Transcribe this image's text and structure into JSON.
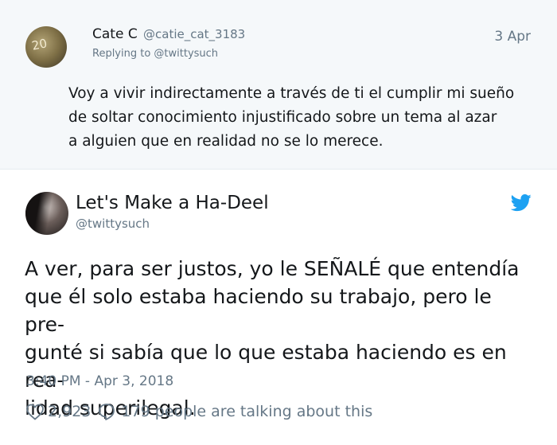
{
  "reply": {
    "name": "Cate C",
    "handle": "@catie_cat_3183",
    "replying_to": "Replying to @twittysuch",
    "date": "3 Apr",
    "lines": [
      "Voy a vivir indirectamente a través de ti el cumplir mi sueño",
      "de soltar conocimiento injustificado sobre un tema al azar",
      "a alguien que en realidad no se lo merece."
    ],
    "avatar_text": "20"
  },
  "tweet": {
    "name": "Let's Make a Ha-Deel",
    "handle": "@twittysuch",
    "lines": [
      "A ver, para ser justos, yo le SEÑALÉ que entendía",
      "que él solo estaba haciendo su trabajo, pero le pre-",
      "gunté si sabía que lo que estaba haciendo es en rea-",
      "lidad superilegal."
    ],
    "timestamp": "3:40 PM - Apr 3, 2018",
    "likes": "2,923",
    "talking": "179 people are talking about this"
  },
  "icons": {
    "brand": "twitter-bird-icon",
    "like": "heart-icon",
    "reply": "comment-bubble-icon"
  },
  "colors": {
    "twitter_blue": "#1da1f2",
    "secondary_text": "#657786",
    "reply_background": "#f5f8fa"
  }
}
